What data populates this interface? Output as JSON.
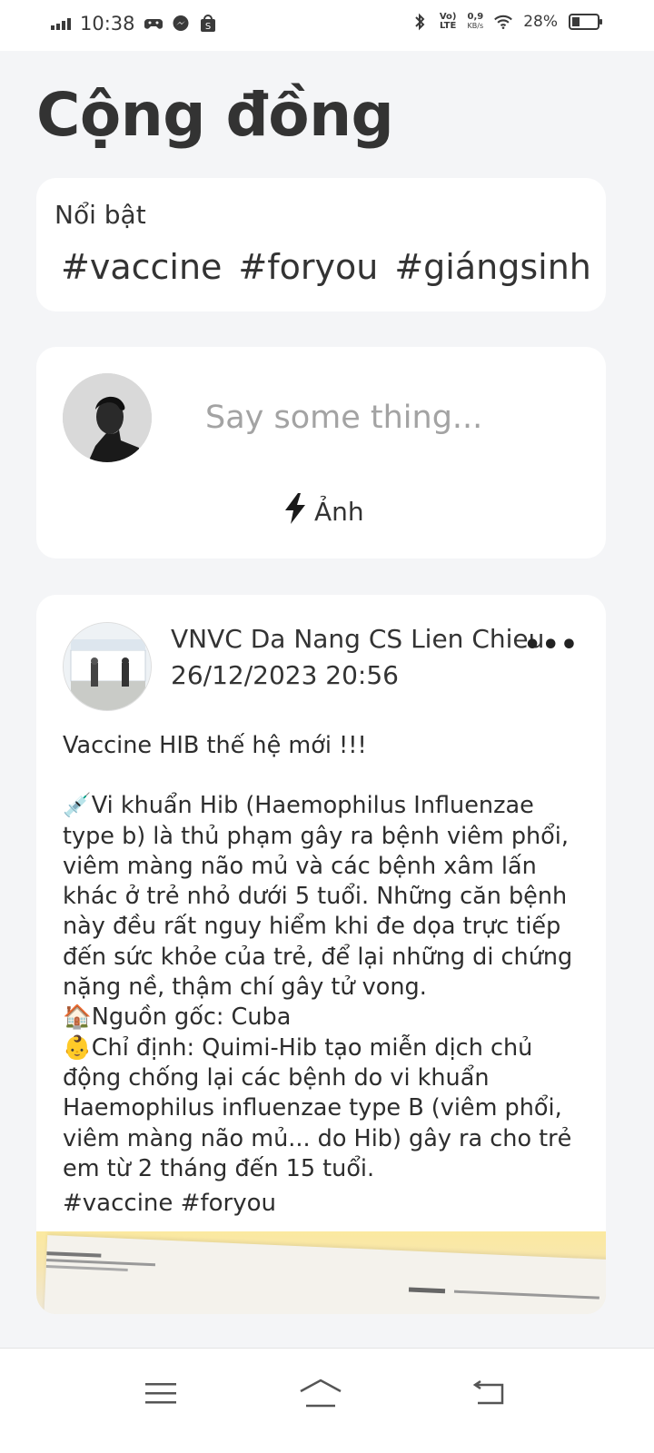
{
  "status_bar": {
    "time": "10:38",
    "battery": "28%",
    "network_speed": "0,9",
    "network_unit": "KB/s",
    "network_type_top": "Vo)",
    "network_type_bottom": "LTE",
    "icons": [
      "signal-icon",
      "game-controller-icon",
      "messenger-icon",
      "shopee-icon",
      "bluetooth-icon",
      "volte-icon",
      "wifi-icon",
      "battery-icon"
    ]
  },
  "page": {
    "title": "Cộng đồng"
  },
  "featured": {
    "label": "Nổi bật",
    "tags": [
      "#vaccine",
      "#foryou",
      "#giángsinh"
    ]
  },
  "composer": {
    "placeholder": "Say some thing...",
    "photo_label": "Ảnh"
  },
  "post": {
    "author": "VNVC Da Nang CS Lien Chieu",
    "timestamp": "26/12/2023 20:56",
    "more_label": "•••",
    "title_line": "Vaccine HIB thế hệ mới !!!",
    "para1": "💉Vi khuẩn Hib (Haemophilus Influenzae type b) là thủ phạm gây ra bệnh viêm phổi, viêm màng não mủ và các bệnh xâm lấn khác ở trẻ nhỏ dưới 5 tuổi. Những căn bệnh này đều rất nguy hiểm khi đe dọa trực tiếp đến sức khỏe của trẻ, để lại những di chứng nặng nề, thậm chí gây tử vong.",
    "para2": "🏠Nguồn gốc: Cuba",
    "para3": "👶Chỉ định: Quimi-Hib tạo miễn dịch chủ động chống lại các bệnh do vi khuẩn Haemophilus influenzae type B (viêm phổi, viêm màng não mủ... do Hib) gây ra cho trẻ em từ 2 tháng đến 15 tuổi.",
    "hashtags": "#vaccine #foryou"
  },
  "nav": {
    "icons": [
      "menu-icon",
      "home-icon",
      "back-icon"
    ]
  }
}
